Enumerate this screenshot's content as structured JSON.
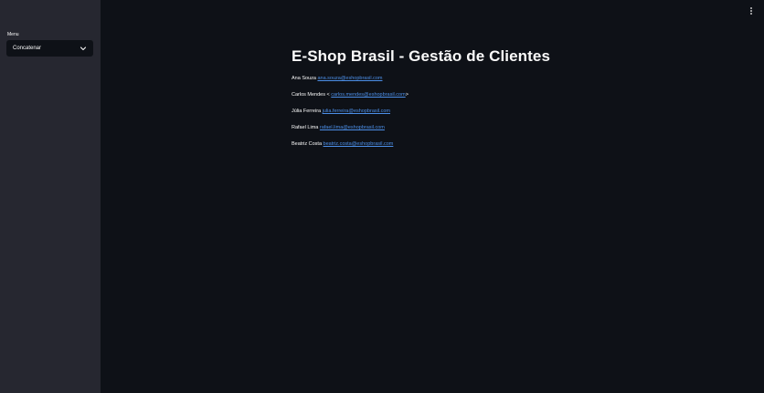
{
  "sidebar": {
    "menu_label": "Menu",
    "select": {
      "value": "Concatenar"
    }
  },
  "main": {
    "title": "E-Shop Brasil - Gestão de Clientes",
    "clients": [
      {
        "name": "Ana Souza",
        "prefix": " ",
        "email": "ana.souza@eshopbrasil.com",
        "suffix": ""
      },
      {
        "name": "Carlos Mendes",
        "prefix": " < ",
        "email": "carlos.mendes@eshopbrasil.com",
        "suffix": ">"
      },
      {
        "name": "Júlia Ferreira",
        "prefix": " ",
        "email": "julia.ferreira@eshopbrasil.com",
        "suffix": ""
      },
      {
        "name": "Rafael Lima",
        "prefix": " ",
        "email": "rafael.lima@eshopbrasil.com",
        "suffix": ""
      },
      {
        "name": "Beatriz Costa",
        "prefix": " ",
        "email": "beatriz.costa@eshopbrasil.com",
        "suffix": ""
      }
    ]
  },
  "colors": {
    "background": "#0e1117",
    "sidebar": "#262730",
    "text": "#fafafa",
    "link": "#4c8fe8"
  },
  "icons": {
    "select_arrow": "chevron-down-icon",
    "main_menu": "more-vertical-icon"
  }
}
